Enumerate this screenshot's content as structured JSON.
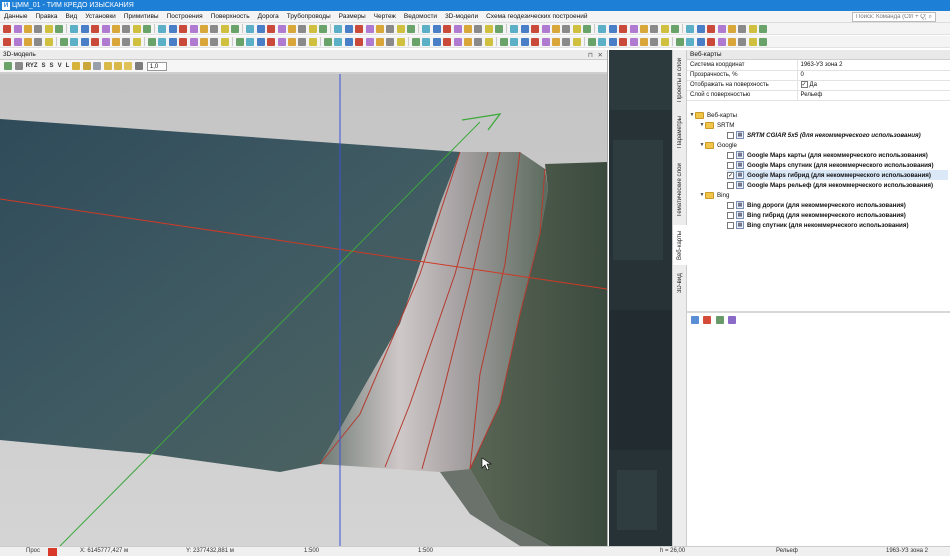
{
  "window": {
    "title": "ЦММ_01 - ТИМ КРЕДО ИЗЫСКАНИЯ"
  },
  "menu": [
    "Данные",
    "Правка",
    "Вид",
    "Установки",
    "Примитивы",
    "Построения",
    "Поверхность",
    "Дорога",
    "Трубопроводы",
    "Размеры",
    "Чертеж",
    "Ведомости",
    "3D-модели",
    "Схема геодезических построений"
  ],
  "search": {
    "placeholder": "Поиск: Команда (Ctrl + Q)"
  },
  "panel3d": {
    "title": "3D-модель",
    "toolbar": [
      "RYZ",
      "S",
      "S",
      "V",
      "L"
    ],
    "zoom_value": "1,0"
  },
  "vertical_tabs": [
    "Проекты и слои",
    "Параметры",
    "Тематические слои",
    "Веб-карты",
    "3D-вид"
  ],
  "right_panel": {
    "title": "Веб-карты",
    "properties": [
      {
        "name": "Система координат",
        "value": "1963-УЗ зона 2"
      },
      {
        "name": "Прозрачность, %",
        "value": "0"
      },
      {
        "name": "Отображать на поверхность",
        "value": "Да"
      },
      {
        "name": "Слой с поверхностью",
        "value": "Рельеф"
      }
    ],
    "tree": {
      "root": "Веб-карты",
      "srtm": "SRTM",
      "srtm_layer": "SRTM CGIAR 5x5 (для некоммерческого использования)",
      "google": "Google",
      "google_layers": [
        "Google Maps карты (для некоммерческого использования)",
        "Google Maps спутник (для некоммерческого использования)",
        "Google Maps гибрид (для некоммерческого использования)",
        "Google Maps рельеф (для некоммерческого использования)"
      ],
      "bing": "Bing",
      "bing_layers": [
        "Bing дороги (для некоммерческого использования)",
        "Bing гибрид (для некоммерческого использования)",
        "Bing спутник (для некоммерческого использования)"
      ]
    }
  },
  "status": {
    "label": "Прос",
    "x": "X: 6145777,427 м",
    "y": "Y: 2377432,881 м",
    "v1": "1:500",
    "v2": "1:500",
    "v3": "h = 26,00",
    "v4": "Рельеф",
    "v5": "1963-УЗ зона 2"
  },
  "colors": {
    "titlebar": "#1e7fd6",
    "selection": "#dbe8f7"
  }
}
